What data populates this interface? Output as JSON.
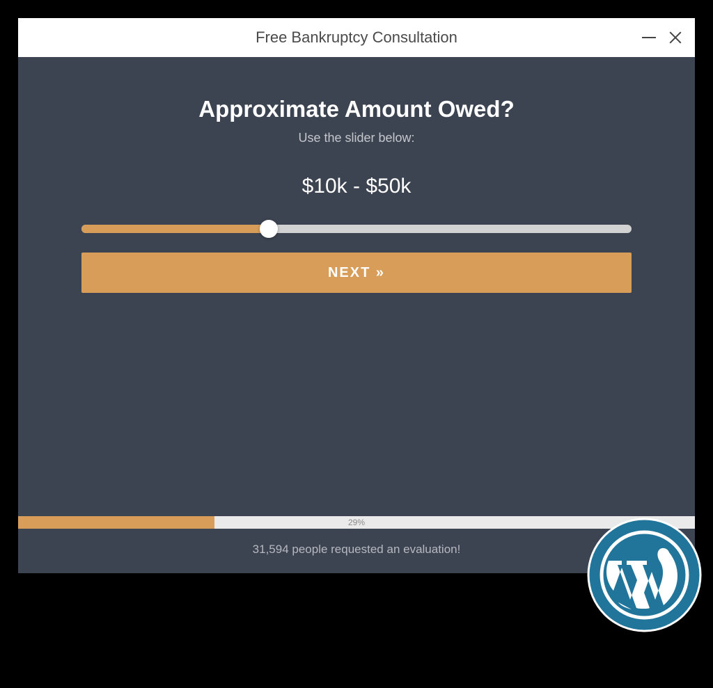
{
  "window": {
    "title": "Free Bankruptcy Consultation"
  },
  "form": {
    "question": "Approximate Amount Owed?",
    "subtitle": "Use the slider below:",
    "value": "$10k - $50k",
    "slider_percent": 34,
    "next_label": "NEXT »"
  },
  "progress": {
    "percent": 29,
    "label": "29%"
  },
  "stats": {
    "text": "31,594 people requested an evaluation!"
  },
  "badge": {
    "name": "wordpress"
  }
}
